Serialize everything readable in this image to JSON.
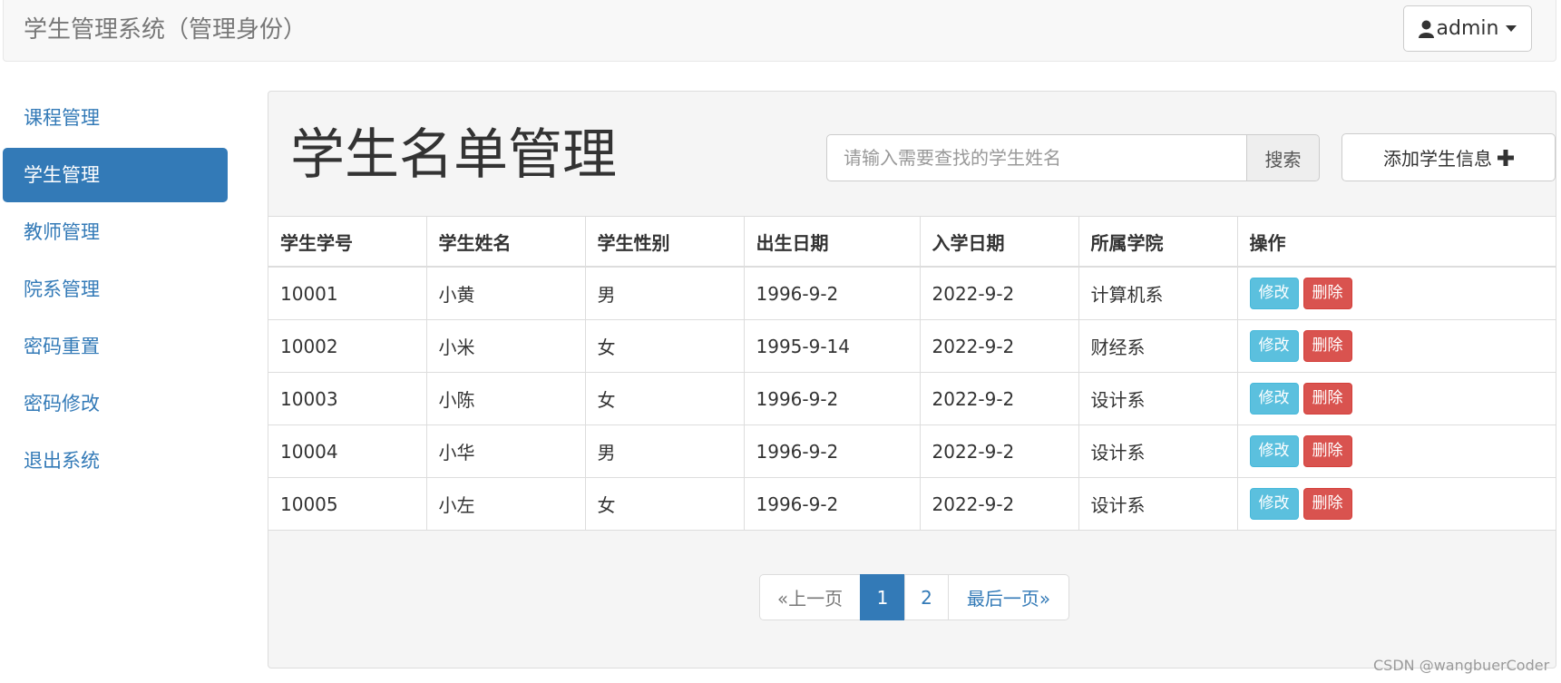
{
  "navbar": {
    "brand": "学生管理系统（管理身份）",
    "user_label": "admin",
    "user_icon": "user-icon",
    "caret_icon": "caret-down-icon"
  },
  "sidebar": {
    "items": [
      {
        "label": "课程管理",
        "active": false
      },
      {
        "label": "学生管理",
        "active": true
      },
      {
        "label": "教师管理",
        "active": false
      },
      {
        "label": "院系管理",
        "active": false
      },
      {
        "label": "密码重置",
        "active": false
      },
      {
        "label": "密码修改",
        "active": false
      },
      {
        "label": "退出系统",
        "active": false
      }
    ]
  },
  "main": {
    "title": "学生名单管理",
    "search": {
      "placeholder": "请输入需要查找的学生姓名",
      "value": "",
      "button_label": "搜索"
    },
    "add_button": {
      "label": "添加学生信息",
      "icon": "plus-icon"
    },
    "table": {
      "columns": [
        "学生学号",
        "学生姓名",
        "学生性别",
        "出生日期",
        "入学日期",
        "所属学院",
        "操作"
      ],
      "rows": [
        {
          "id": "10001",
          "name": "小黄",
          "gender": "男",
          "birth": "1996-9-2",
          "enroll": "2022-9-2",
          "college": "计算机系"
        },
        {
          "id": "10002",
          "name": "小米",
          "gender": "女",
          "birth": "1995-9-14",
          "enroll": "2022-9-2",
          "college": "财经系"
        },
        {
          "id": "10003",
          "name": "小陈",
          "gender": "女",
          "birth": "1996-9-2",
          "enroll": "2022-9-2",
          "college": "设计系"
        },
        {
          "id": "10004",
          "name": "小华",
          "gender": "男",
          "birth": "1996-9-2",
          "enroll": "2022-9-2",
          "college": "设计系"
        },
        {
          "id": "10005",
          "name": "小左",
          "gender": "女",
          "birth": "1996-9-2",
          "enroll": "2022-9-2",
          "college": "设计系"
        }
      ],
      "edit_label": "修改",
      "delete_label": "删除"
    },
    "pagination": {
      "prev": "«上一页",
      "pages": [
        "1",
        "2"
      ],
      "current": "1",
      "last": "最后一页»"
    }
  },
  "watermark": "CSDN @wangbuerCoder",
  "colors": {
    "primary": "#337ab7",
    "info": "#5bc0de",
    "danger": "#d9534f",
    "panel_bg": "#f5f5f5",
    "navbar_bg": "#f8f8f8"
  }
}
